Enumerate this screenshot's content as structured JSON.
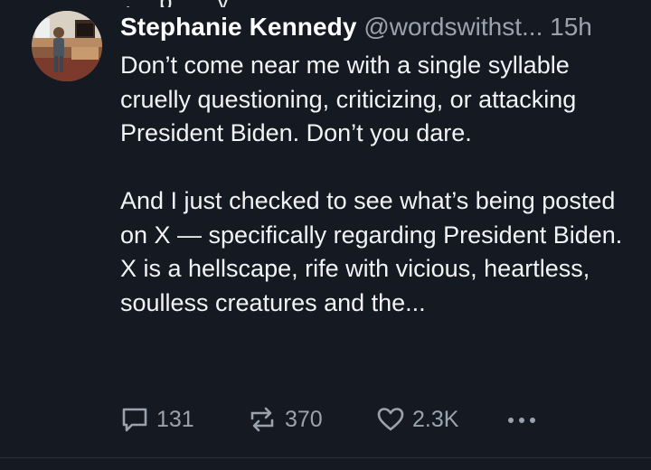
{
  "post": {
    "author": {
      "display_name": "Stephanie Kennedy",
      "handle": "@wordswithst...",
      "avatar": "profile-photo"
    },
    "timestamp": "15h",
    "text": "Don’t come near me with a single syllable cruelly questioning, criticizing, or attacking President Biden. Don’t you dare.\n\nAnd I just checked to see what’s being posted on X — specifically regarding President Biden. X is a hellscape, rife with vicious, heartless, soulless creatures and the...",
    "actions": {
      "replies": "131",
      "reposts": "370",
      "likes": "2.3K"
    }
  },
  "colors": {
    "background": "#151a22",
    "text_primary": "#f2f3f5",
    "text_secondary": "#9aa3ad"
  },
  "icons": [
    "reply-icon",
    "repost-icon",
    "like-icon",
    "more-icon"
  ]
}
